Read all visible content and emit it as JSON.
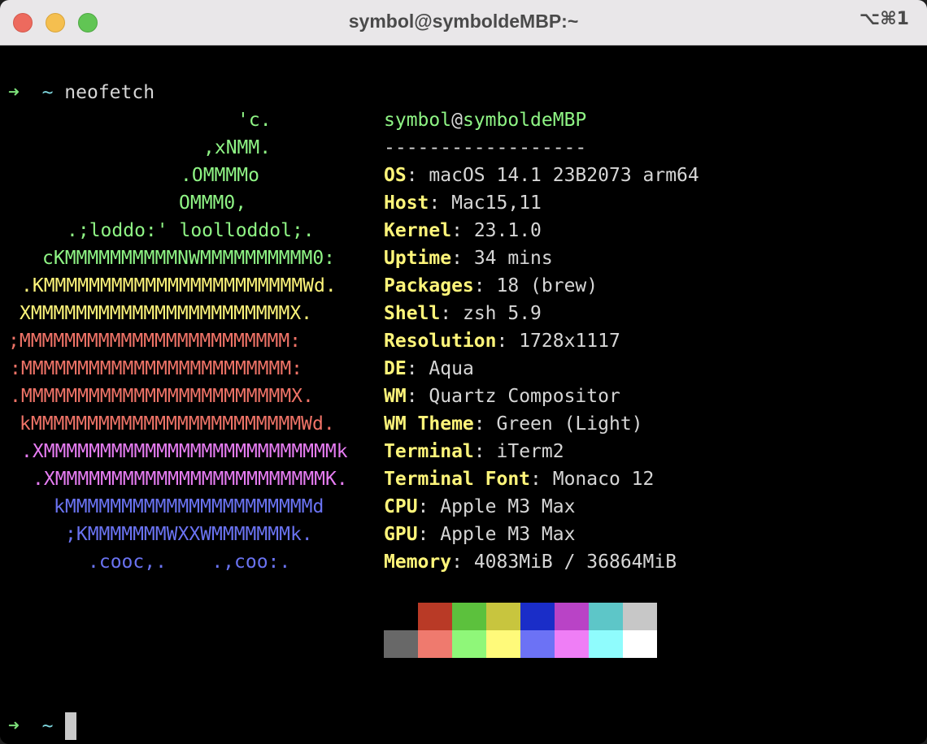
{
  "window": {
    "title": "symbol@symboldeMBP:~",
    "shortcut": "⌥⌘1"
  },
  "prompt": {
    "arrow": "➜",
    "cwd": "~",
    "command": "neofetch"
  },
  "logo": [
    {
      "text": "'c.",
      "color": "green"
    },
    {
      "text": ",xNMM.",
      "color": "green"
    },
    {
      "text": ".OMMMMo",
      "color": "green"
    },
    {
      "text": "OMMM0,",
      "color": "green"
    },
    {
      "text": ".;loddo:' loolloddol;.",
      "color": "green"
    },
    {
      "text": "cKMMMMMMMMMMNWMMMMMMMMMM0:",
      "color": "green"
    },
    {
      "text": ".KMMMMMMMMMMMMMMMMMMMMMMMWd.",
      "color": "yellow"
    },
    {
      "text": "XMMMMMMMMMMMMMMMMMMMMMMMX.",
      "color": "yellow"
    },
    {
      "text": ";MMMMMMMMMMMMMMMMMMMMMMMM:",
      "color": "red"
    },
    {
      "text": ":MMMMMMMMMMMMMMMMMMMMMMMM:",
      "color": "red"
    },
    {
      "text": ".MMMMMMMMMMMMMMMMMMMMMMMMX.",
      "color": "red"
    },
    {
      "text": "kMMMMMMMMMMMMMMMMMMMMMMMMWd.",
      "color": "red"
    },
    {
      "text": ".XMMMMMMMMMMMMMMMMMMMMMMMMMMk",
      "color": "magenta"
    },
    {
      "text": ".XMMMMMMMMMMMMMMMMMMMMMMMMK.",
      "color": "magenta"
    },
    {
      "text": "kMMMMMMMMMMMMMMMMMMMMMMd",
      "color": "blue"
    },
    {
      "text": ";KMMMMMMMWXXWMMMMMMMk.",
      "color": "blue"
    },
    {
      "text": ".cooc,.    .,coo:.",
      "color": "blue"
    }
  ],
  "info": {
    "user": "symbol",
    "at": "@",
    "host": "symboldeMBP",
    "separator": "------------------",
    "fields": [
      {
        "key": "OS",
        "value": "macOS 14.1 23B2073 arm64"
      },
      {
        "key": "Host",
        "value": "Mac15,11"
      },
      {
        "key": "Kernel",
        "value": "23.1.0"
      },
      {
        "key": "Uptime",
        "value": "34 mins"
      },
      {
        "key": "Packages",
        "value": "18 (brew)"
      },
      {
        "key": "Shell",
        "value": "zsh 5.9"
      },
      {
        "key": "Resolution",
        "value": "1728x1117"
      },
      {
        "key": "DE",
        "value": "Aqua"
      },
      {
        "key": "WM",
        "value": "Quartz Compositor"
      },
      {
        "key": "WM Theme",
        "value": "Green (Light)"
      },
      {
        "key": "Terminal",
        "value": "iTerm2"
      },
      {
        "key": "Terminal Font",
        "value": "Monaco 12"
      },
      {
        "key": "CPU",
        "value": "Apple M3 Max"
      },
      {
        "key": "GPU",
        "value": "Apple M3 Max"
      },
      {
        "key": "Memory",
        "value": "4083MiB / 36864MiB"
      }
    ],
    "key_value_separator": ":"
  },
  "palette": {
    "normal": [
      "#000000",
      "#b93a26",
      "#5cc13d",
      "#c8c53e",
      "#1a2dc8",
      "#b943c6",
      "#5dc6c8",
      "#c7c7c7"
    ],
    "bright": [
      "#686868",
      "#ef7a6e",
      "#8ff779",
      "#fffa7a",
      "#6c72f5",
      "#ef7ef6",
      "#8ffcfd",
      "#ffffff"
    ]
  },
  "prompt2": {
    "arrow": "➜",
    "cwd": "~"
  }
}
